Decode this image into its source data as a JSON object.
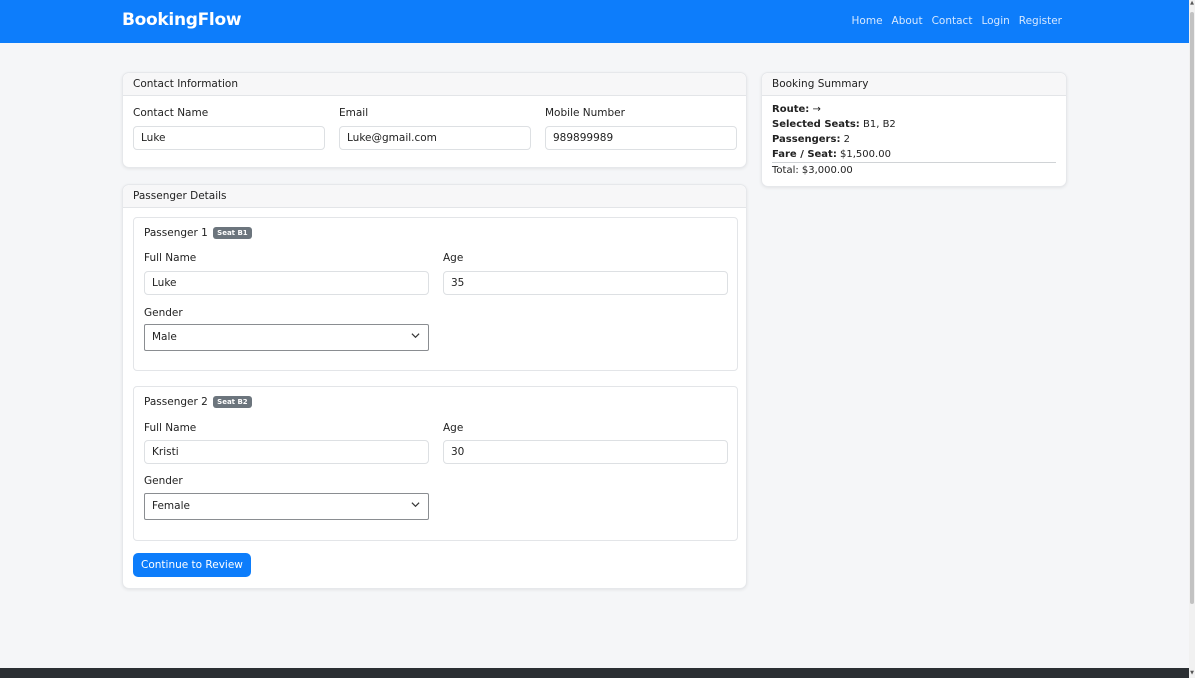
{
  "nav": {
    "brand": "BookingFlow",
    "links": [
      "Home",
      "About",
      "Contact",
      "Login",
      "Register"
    ]
  },
  "contact": {
    "header": "Contact Information",
    "name_label": "Contact Name",
    "name_value": "Luke",
    "email_label": "Email",
    "email_value": "Luke@gmail.com",
    "mobile_label": "Mobile Number",
    "mobile_value": "989899989"
  },
  "passengers": {
    "header": "Passenger Details",
    "items": [
      {
        "title": "Passenger 1",
        "seat_badge": "Seat B1",
        "name_label": "Full Name",
        "name_value": "Luke",
        "age_label": "Age",
        "age_value": "35",
        "gender_label": "Gender",
        "gender_value": "Male"
      },
      {
        "title": "Passenger 2",
        "seat_badge": "Seat B2",
        "name_label": "Full Name",
        "name_value": "Kristi",
        "age_label": "Age",
        "age_value": "30",
        "gender_label": "Gender",
        "gender_value": "Female"
      }
    ],
    "continue_label": "Continue to Review"
  },
  "summary": {
    "header": "Booking Summary",
    "route_label": "Route:",
    "route_value": "→",
    "seats_label": "Selected Seats:",
    "seats_value": "B1, B2",
    "passengers_label": "Passengers:",
    "passengers_value": "2",
    "fare_label": "Fare / Seat:",
    "fare_value": "$1,500.00",
    "total": "Total: $3,000.00"
  },
  "colors": {
    "primary": "#0d7dfb",
    "badge": "#6c757d",
    "footer": "#2b2f33"
  },
  "icons": {
    "select_chevron": "chevron-down-icon"
  }
}
